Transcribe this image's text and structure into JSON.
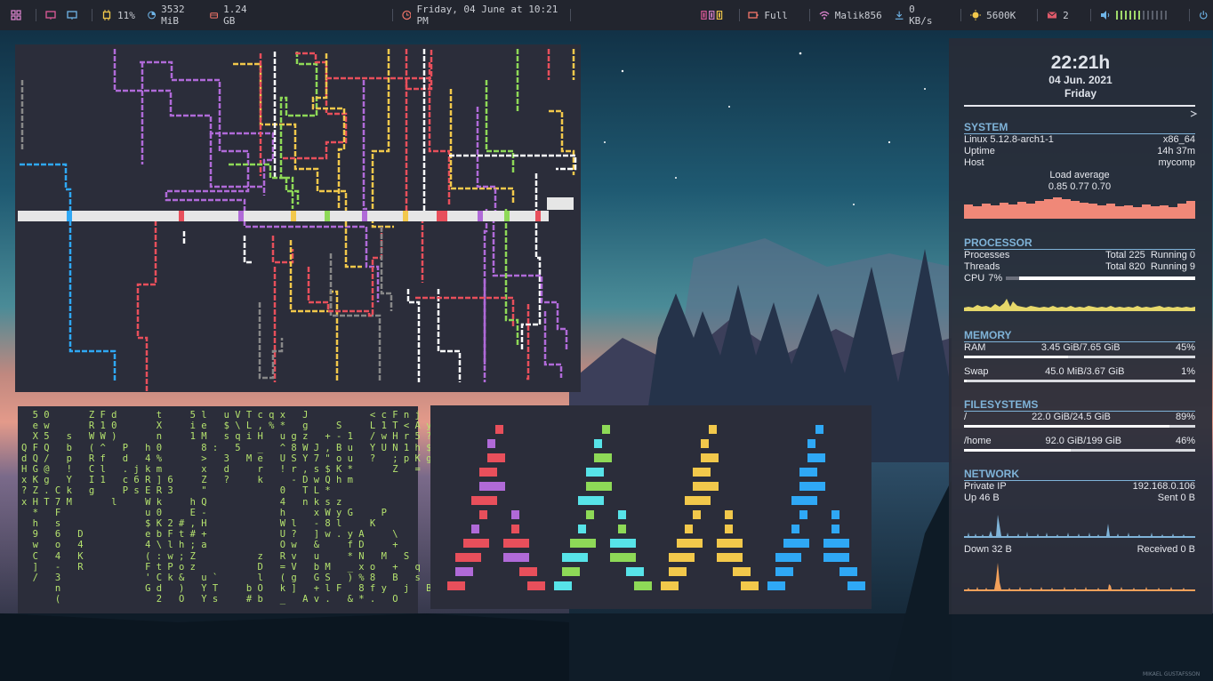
{
  "topbar": {
    "workspaces_icon": "grid-icon",
    "cpu_percent": "11%",
    "memory_used": "3532 MiB",
    "disk_used": "1.24 GB",
    "datetime": "Friday, 04 June at 10:21 PM",
    "battery_status": "Full",
    "wifi_ssid": "Malik856",
    "net_speed": "0 KB/s",
    "color_temp": "5600K",
    "mail_count": "2",
    "colors": {
      "accent": "#f4766a",
      "yellow": "#f2c84b",
      "pink": "#d681c8",
      "blue": "#6fb5e8",
      "green": "#9fd96a",
      "red": "#e05a6a"
    }
  },
  "conky": {
    "time": "22:21h",
    "date": "04 Jun. 2021",
    "weekday": "Friday",
    "system": {
      "title": "SYSTEM",
      "kernel": "Linux 5.12.8-arch1-1",
      "arch": "x86_64",
      "uptime_label": "Uptime",
      "uptime": "14h 37m",
      "host_label": "Host",
      "host": "mycomp",
      "load_label": "Load average",
      "load": "0.85 0.77 0.70"
    },
    "processor": {
      "title": "PROCESSOR",
      "processes_label": "Processes",
      "processes": "Total 225  Running 0",
      "threads_label": "Threads",
      "threads": "Total 820  Running 9",
      "cpu_label": "CPU",
      "cpu_value": "7%",
      "cpu_fraction": 0.07
    },
    "memory": {
      "title": "MEMORY",
      "ram_label": "RAM",
      "ram": "3.45 GiB/7.65 GiB",
      "ram_pct": "45%",
      "ram_fraction": 0.45,
      "swap_label": "Swap",
      "swap": "45.0 MiB/3.67 GiB",
      "swap_pct": "1%",
      "swap_fraction": 0.01
    },
    "filesystems": {
      "title": "FILESYSTEMS",
      "root_label": "/",
      "root": "22.0 GiB/24.5 GiB",
      "root_pct": "89%",
      "root_fraction": 0.89,
      "home_label": "/home",
      "home": "92.0 GiB/199 GiB",
      "home_pct": "46%",
      "home_fraction": 0.46
    },
    "network": {
      "title": "NETWORK",
      "ip_label": "Private IP",
      "ip": "192.168.0.106",
      "up": "Up 46 B",
      "sent": "Sent 0 B",
      "down": "Down 32 B",
      "received": "Received 0 B"
    }
  },
  "matrix_lines": [
    "  5 0       Z F d       t     5 l   u V T c q x   J           < c F n j",
    "  e w       R 1 0       X     i e   $ \\ L , % *   g     S     L 1 T < A y",
    "  X 5   s   W W )       n     1 M   s q i H   u g z   + - 1   / w H r 5 ?",
    "Q F Q   b   ( ^   P   h 0       8 :   5   _   ^ 8 W J , B u   Y U N 1 h $",
    "d Q /   p   R f   d   4 %       >   3   M e   U S Y 7 \" o u   ?   ; p K g",
    "H G @   !   C l   . j k m       x   d     r   ! r , s $ K *       Z   =",
    "x K g   Y   I 1   c 6 R ] 6     Z   ?     k     - D w Q h m",
    "? Z . C k   g     P s E R 3     \"             0   T L *",
    "x H T 7 M       l     W k     h Q             4   n k s z",
    "  *   F               u 0     E -             h     x W y G     P",
    "  h   s               $ K 2 # , H             W l   - 8 l     K",
    "  9   6   D           e b F t # +             U ?   ] w . y A     \\",
    "  w   o   4           4 \\ l h ; a             O w   &     f D     +",
    "  C   4   K           ( : w ; Z           z   R v   u     * N   M   S",
    "  ]   -   R           F t P o z           D   = V   b M   _ x o   +   q",
    "  /   3               ' C k &   u `       l   ( g   G S   ) % 8   B   s",
    "      n               G d   )   Y T     b O   k ]   + l F   8 f y   j   B",
    "      (                 2   O   Y s     # b   _   A v .   & * .   O"
  ],
  "trees": [
    {
      "color": "#e84f5b",
      "palette": [
        "#e84f5b",
        "#b06ad8",
        "#e84f5b"
      ]
    },
    {
      "color": "#8ed957",
      "palette": [
        "#8ed957",
        "#57e3e8"
      ]
    },
    {
      "color": "#f2c84b",
      "palette": [
        "#f2c84b"
      ]
    },
    {
      "color": "#2fa8f5",
      "palette": [
        "#2fa8f5"
      ]
    }
  ],
  "watermark": "MIKAEL GUSTAFSSON"
}
